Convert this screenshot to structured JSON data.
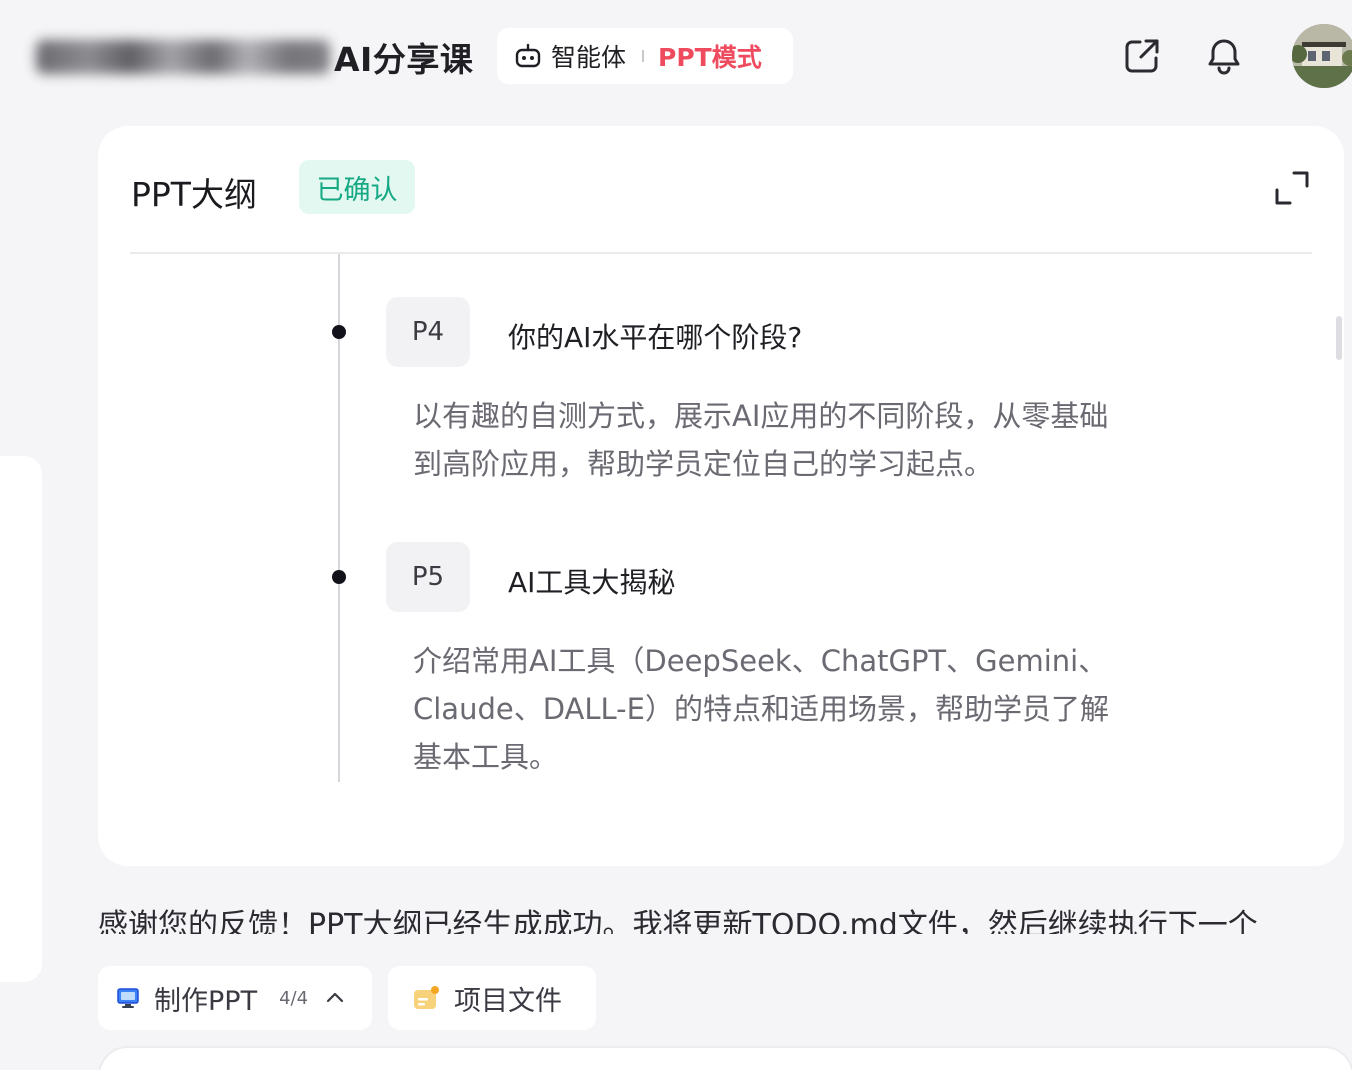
{
  "header": {
    "title_suffix": "AI分享课",
    "mode_agent_label": "智能体",
    "mode_ppt_label": "PPT模式"
  },
  "outline_card": {
    "title": "PPT大纲",
    "status_badge": "已确认",
    "items": [
      {
        "page": "P4",
        "title": "你的AI水平在哪个阶段?",
        "description_lines": [
          "以有趣的自测方式，展示AI应用的不同阶段，从零基础",
          "到高阶应用，帮助学员定位自己的学习起点。"
        ]
      },
      {
        "page": "P5",
        "title": "AI工具大揭秘",
        "description_lines": [
          "介绍常用AI工具（DeepSeek、ChatGPT、Gemini、",
          "Claude、DALL-E）的特点和适用场景，帮助学员了解",
          "基本工具。"
        ]
      }
    ]
  },
  "message_text": "感谢您的反馈！PPT大纲已经生成成功。我将更新TODO.md文件，然后继续执行下一个",
  "bottom_bar": {
    "make_ppt_label": "制作PPT",
    "make_ppt_progress": "4/4",
    "project_files_label": "项目文件"
  },
  "icons": {
    "agent": "robot-icon",
    "share": "share-external-icon",
    "notifications": "bell-icon",
    "expand": "expand-icon",
    "make_ppt": "monitor-icon",
    "project_files": "folder-note-icon",
    "collapse": "chevron-up-icon"
  },
  "colors": {
    "accent_ppt": "#ef4b5f",
    "confirmed_badge_bg": "#e2f8f1",
    "confirmed_badge_text": "#17a884",
    "page_background": "#f5f5f7"
  }
}
